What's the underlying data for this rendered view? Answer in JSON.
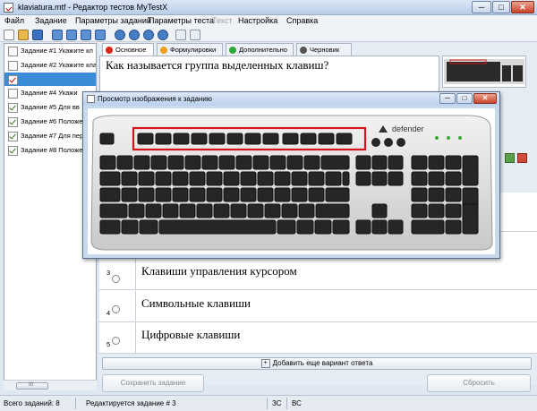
{
  "window": {
    "title": "klaviatura.mtf - Редактор тестов MyTestX"
  },
  "window_controls": {
    "minimize": "─",
    "maximize": "□",
    "close": "✕"
  },
  "menu": [
    "Файл",
    "Задание",
    "Параметры заданий",
    "Параметры теста",
    "Текст",
    "Настройка",
    "Справка"
  ],
  "tasks": [
    {
      "label": "Задание #1 Укажите кл",
      "checked": false
    },
    {
      "label": "Задание #2 Укажите клави",
      "checked": false
    },
    {
      "label": "",
      "checked": true,
      "selected": true
    },
    {
      "label": "Задание #4 Укажи",
      "checked": false
    },
    {
      "label": "Задание #5 Для вв",
      "checked": true
    },
    {
      "label": "Задание #6 Положе",
      "checked": true
    },
    {
      "label": "Задание #7 Для пер",
      "checked": true
    },
    {
      "label": "Задание #8 Положе",
      "checked": true
    }
  ],
  "scroll": {
    "thumb_label": "III"
  },
  "tabs": [
    {
      "label": "Основное",
      "color": "#d9261c"
    },
    {
      "label": "Формулировки",
      "color": "#f0a020"
    },
    {
      "label": "Дополнительно",
      "color": "#2fa83a"
    },
    {
      "label": "Черновик",
      "color": "#555555"
    }
  ],
  "question": {
    "text": "Как называется группа выделенных клавиш?"
  },
  "answers": [
    {
      "num": "3",
      "text": "Клавиши управления курсором"
    },
    {
      "num": "4",
      "text": "Символьные клавиши"
    },
    {
      "num": "5",
      "text": "Цифровые клавиши"
    }
  ],
  "add_answer": {
    "label": "Добавить еще вариант ответа",
    "plus": "+"
  },
  "buttons": {
    "save": "Сохранить задание",
    "reset": "Сбросить"
  },
  "status": {
    "total": "Всего заданий: 8",
    "editing": "Редактируется задание # 3",
    "caps": "ЗС",
    "num": "ВС"
  },
  "dialog": {
    "title": "Просмотр изображения к заданию",
    "brand": "defender"
  },
  "colors": {
    "highlight": "#d4161c",
    "selection": "#3b8cd8"
  }
}
